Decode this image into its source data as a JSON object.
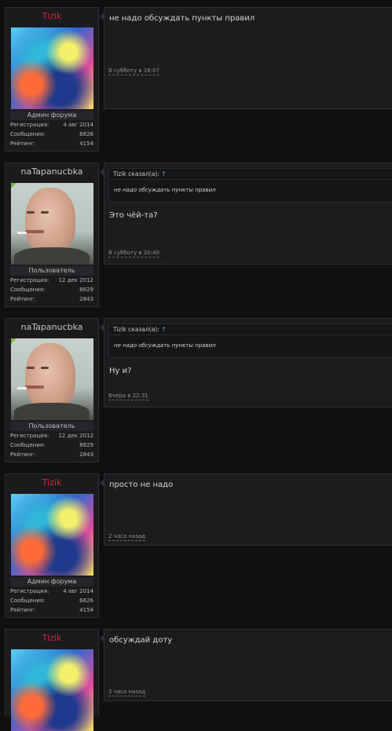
{
  "posts": [
    {
      "author": "Tizik",
      "role": "Админ форума",
      "stats": {
        "reg_label": "Регистрация:",
        "reg": "4 авг 2014",
        "msg_label": "Сообщения:",
        "msgs": "6626",
        "rating_label": "Рейтинг:",
        "rating": "4154"
      },
      "text": "не надо обсуждать пункты правил",
      "time": "В субботу в 16:07"
    },
    {
      "author": "naTapanucbka",
      "role": "Пользователь",
      "stats": {
        "reg_label": "Регистрация:",
        "reg": "12 дек 2012",
        "msg_label": "Сообщения:",
        "msgs": "8829",
        "rating_label": "Рейтинг:",
        "rating": "2843"
      },
      "quote_author": "Tizik сказал(а):",
      "quote_arrow": "↑",
      "quote_text": "не надо обсуждать пункты правил",
      "text": "Это чёй-та?",
      "time": "В субботу в 20:40"
    },
    {
      "author": "naTapanucbka",
      "role": "Пользователь",
      "stats": {
        "reg_label": "Регистрация:",
        "reg": "12 дек 2012",
        "msg_label": "Сообщения:",
        "msgs": "8829",
        "rating_label": "Рейтинг:",
        "rating": "2843"
      },
      "quote_author": "Tizik сказал(а):",
      "quote_arrow": "↑",
      "quote_text": "не надо обсуждать пункты правил",
      "text": "Ну и?",
      "time": "Вчера в 22:31"
    },
    {
      "author": "Tizik",
      "role": "Админ форума",
      "stats": {
        "reg_label": "Регистрация:",
        "reg": "4 авг 2014",
        "msg_label": "Сообщения:",
        "msgs": "6626",
        "rating_label": "Рейтинг:",
        "rating": "4154"
      },
      "text": "просто не надо",
      "time": "2 часа назад"
    },
    {
      "author": "Tizik",
      "text": "обсуждай доту",
      "time": "2 часа назад"
    }
  ]
}
